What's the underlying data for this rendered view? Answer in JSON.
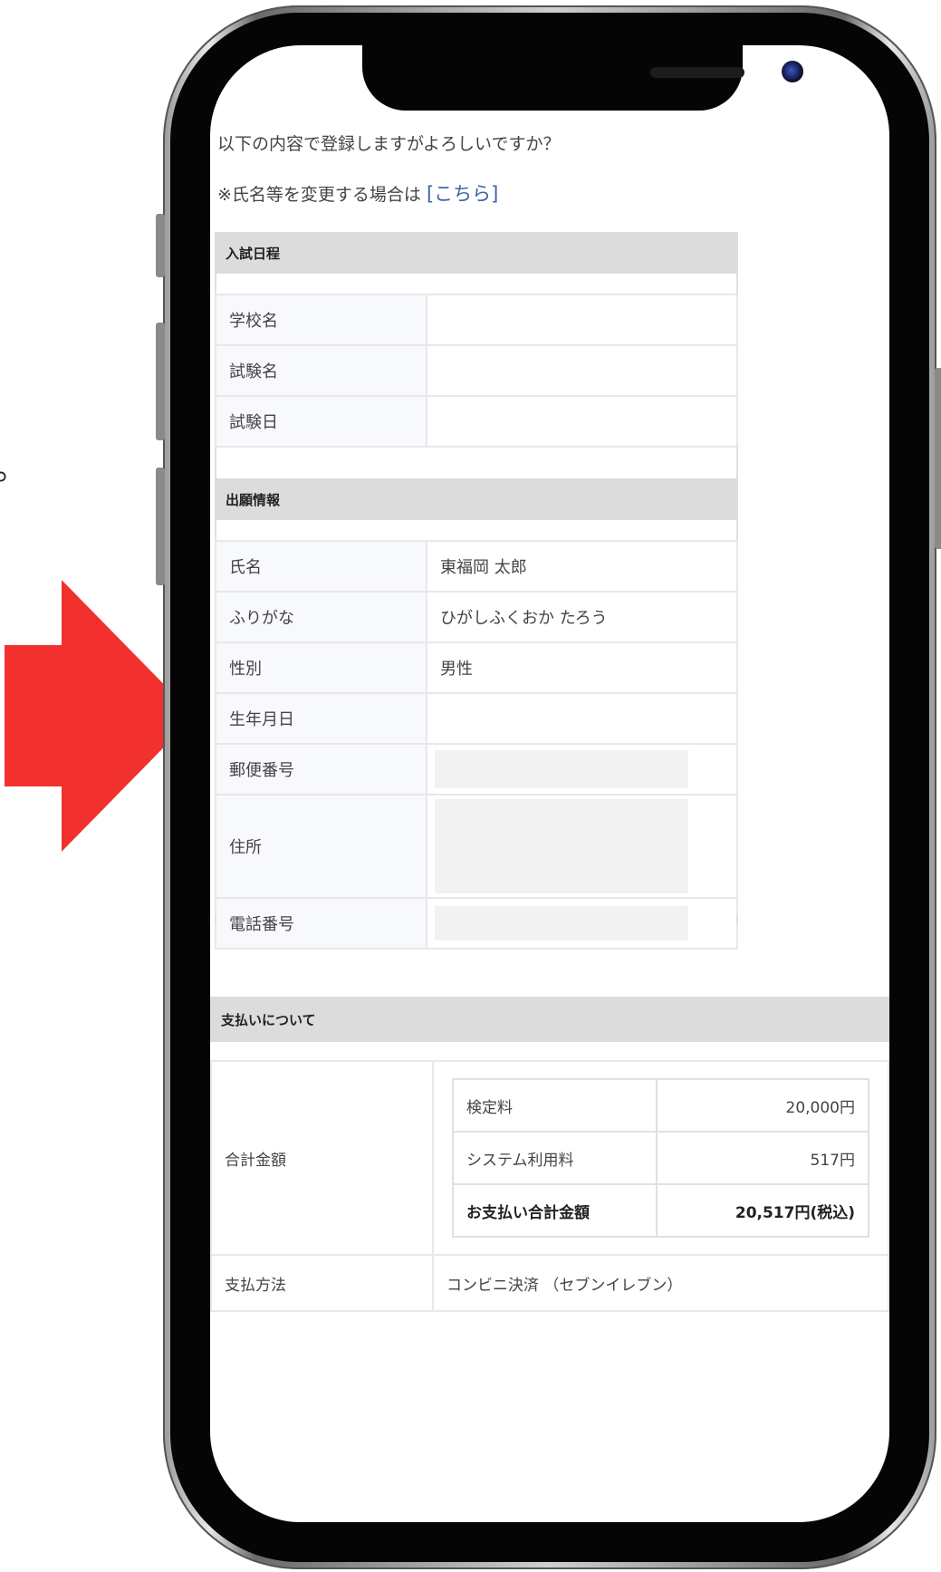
{
  "edge_glyph": "。",
  "intro": {
    "line1": "以下の内容で登録しますがよろしいですか？",
    "line2_prefix": "※氏名等を変更する場合は ",
    "line2_link": "[こちら]"
  },
  "schedule": {
    "header": "入試日程",
    "rows": [
      {
        "label": "学校名",
        "value": ""
      },
      {
        "label": "試験名",
        "value": ""
      },
      {
        "label": "試験日",
        "value": ""
      }
    ]
  },
  "application": {
    "header": "出願情報",
    "rows": [
      {
        "label": "氏名",
        "value": "東福岡 太郎"
      },
      {
        "label": "ふりがな",
        "value": "ひがしふくおか たろう"
      },
      {
        "label": "性別",
        "value": "男性"
      },
      {
        "label": "生年月日",
        "value": ""
      },
      {
        "label": "郵便番号",
        "value": ""
      },
      {
        "label": "住所",
        "value": ""
      },
      {
        "label": "電話番号",
        "value": ""
      }
    ]
  },
  "payment": {
    "header": "支払いについて",
    "total_label": "合計金額",
    "fees": [
      {
        "label": "検定料",
        "amount": "20,000円"
      },
      {
        "label": "システム利用料",
        "amount": "517円"
      },
      {
        "label": "お支払い合計金額",
        "amount": "20,517円(税込)"
      }
    ],
    "method_label": "支払方法",
    "method_value": "コンビニ決済 （セブンイレブン）"
  },
  "colors": {
    "arrow": "#f2312f",
    "link": "#3a63a8",
    "section_header": "#dcdcdc"
  }
}
